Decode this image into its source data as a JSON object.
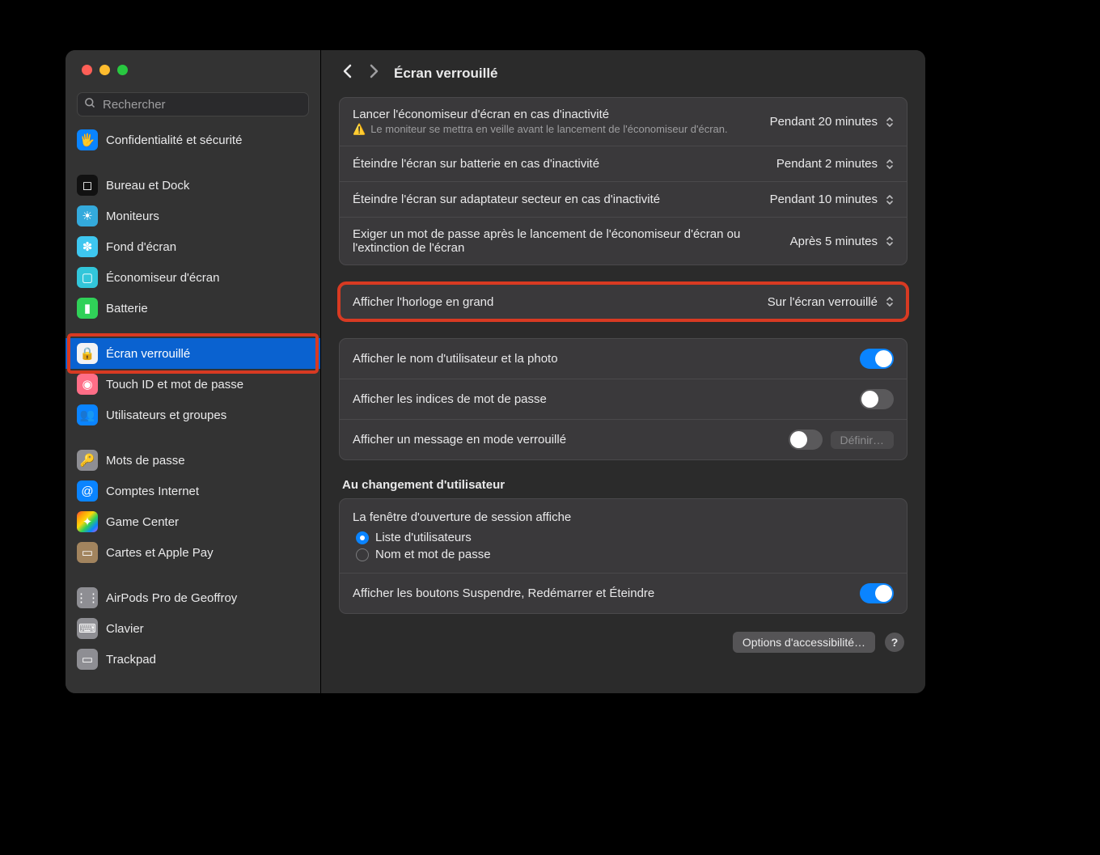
{
  "search": {
    "placeholder": "Rechercher"
  },
  "sidebar": {
    "items": [
      {
        "label": "Confidentialité et sécurité",
        "icon": "🖐",
        "cls": "ic-blue"
      },
      {
        "gap": true
      },
      {
        "label": "Bureau et Dock",
        "icon": "◻",
        "cls": "ic-black"
      },
      {
        "label": "Moniteurs",
        "icon": "☀",
        "cls": "ic-bluelt"
      },
      {
        "label": "Fond d'écran",
        "icon": "✽",
        "cls": "ic-cyan"
      },
      {
        "label": "Économiseur d'écran",
        "icon": "▢",
        "cls": "ic-teal"
      },
      {
        "label": "Batterie",
        "icon": "▮",
        "cls": "ic-green"
      },
      {
        "gap": true
      },
      {
        "label": "Écran verrouillé",
        "icon": "🔒",
        "cls": "ic-white",
        "selected": true,
        "highlight": true
      },
      {
        "label": "Touch ID et mot de passe",
        "icon": "◉",
        "cls": "ic-pink"
      },
      {
        "label": "Utilisateurs et groupes",
        "icon": "👥",
        "cls": "ic-blue"
      },
      {
        "gap": true
      },
      {
        "label": "Mots de passe",
        "icon": "🔑",
        "cls": "ic-grey"
      },
      {
        "label": "Comptes Internet",
        "icon": "@",
        "cls": "ic-blue"
      },
      {
        "label": "Game Center",
        "icon": "✦",
        "cls": "ic-multi"
      },
      {
        "label": "Cartes et Apple Pay",
        "icon": "▭",
        "cls": "ic-brown"
      },
      {
        "gap": true
      },
      {
        "label": "AirPods Pro de Geoffroy",
        "icon": "⋮⋮",
        "cls": "ic-grey"
      },
      {
        "label": "Clavier",
        "icon": "⌨",
        "cls": "ic-grey"
      },
      {
        "label": "Trackpad",
        "icon": "▭",
        "cls": "ic-grey"
      }
    ]
  },
  "header": {
    "title": "Écran verrouillé"
  },
  "panels": {
    "p1": {
      "rows": [
        {
          "title": "Lancer l'économiseur d'écran en cas d'inactivité",
          "value": "Pendant 20 minutes",
          "warn": true,
          "sub": "Le moniteur se mettra en veille avant le lancement de l'économiseur d'écran."
        },
        {
          "title": "Éteindre l'écran sur batterie en cas d'inactivité",
          "value": "Pendant 2 minutes"
        },
        {
          "title": "Éteindre l'écran sur adaptateur secteur en cas d'inactivité",
          "value": "Pendant 10 minutes"
        },
        {
          "title": "Exiger un mot de passe après le lancement de l'économiseur d'écran ou l'extinction de l'écran",
          "value": "Après 5 minutes"
        }
      ]
    },
    "p2": {
      "highlight": true,
      "rows": [
        {
          "title": "Afficher l'horloge en grand",
          "value": "Sur l'écran verrouillé"
        }
      ]
    },
    "p3": {
      "rows": [
        {
          "title": "Afficher le nom d'utilisateur et la photo",
          "toggle": true
        },
        {
          "title": "Afficher les indices de mot de passe",
          "toggle": false
        },
        {
          "title": "Afficher un message en mode verrouillé",
          "toggle": false,
          "btn": "Définir…"
        }
      ]
    },
    "p4": {
      "heading": "Au changement d'utilisateur",
      "radio_title": "La fenêtre d'ouverture de session affiche",
      "radios": [
        {
          "label": "Liste d'utilisateurs",
          "selected": true
        },
        {
          "label": "Nom et mot de passe",
          "selected": false
        }
      ],
      "row": {
        "title": "Afficher les boutons Suspendre, Redémarrer et Éteindre",
        "toggle": true
      }
    }
  },
  "footer": {
    "btn": "Options d'accessibilité…",
    "help": "?"
  }
}
